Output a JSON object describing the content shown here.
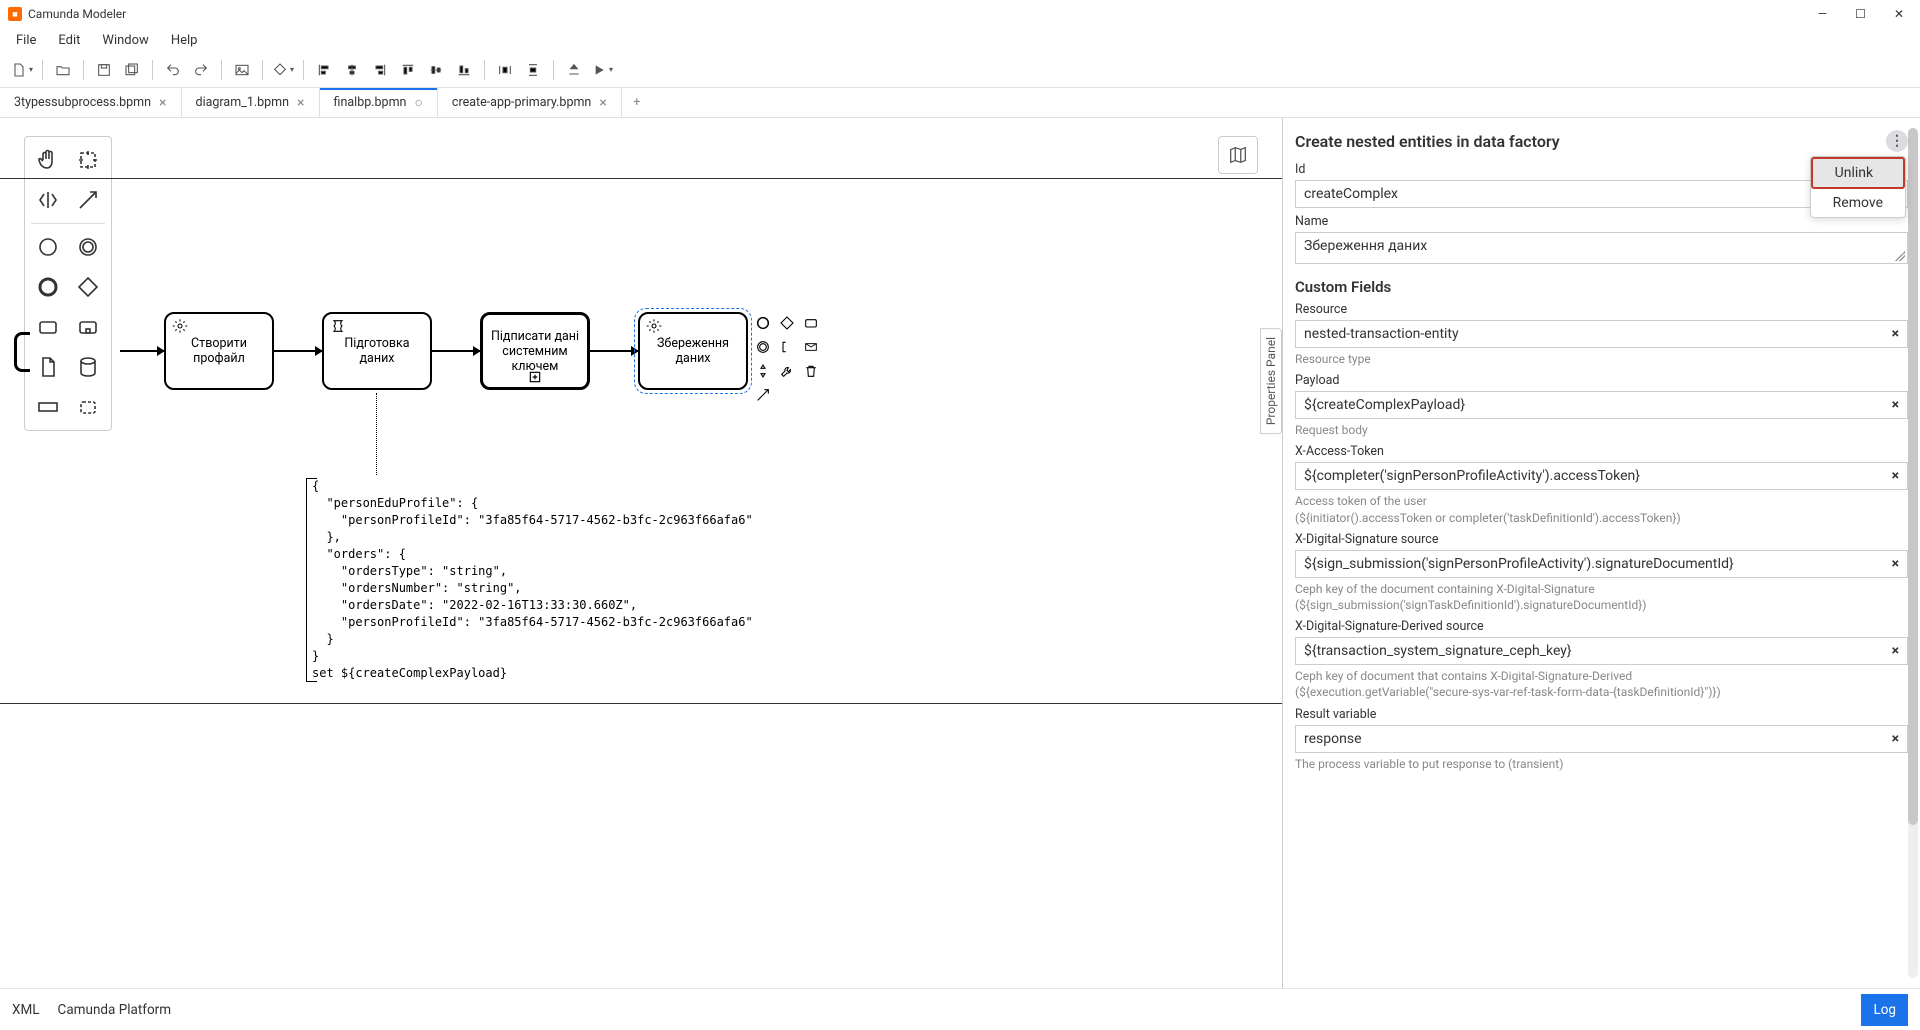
{
  "app_title": "Camunda Modeler",
  "menubar": [
    "File",
    "Edit",
    "Window",
    "Help"
  ],
  "tabs": [
    {
      "label": "3typessubprocess.bpmn",
      "active": false,
      "dirty": false
    },
    {
      "label": "diagram_1.bpmn",
      "active": false,
      "dirty": false
    },
    {
      "label": "finalbp.bpmn",
      "active": true,
      "dirty": true
    },
    {
      "label": "create-app-primary.bpmn",
      "active": false,
      "dirty": false
    }
  ],
  "palette_icons": [
    "hand",
    "lasso",
    "space",
    "connect",
    "start-event",
    "inter-event",
    "end-event",
    "gateway",
    "task",
    "sub",
    "data-object",
    "data-store",
    "pool",
    "group"
  ],
  "tasks": [
    {
      "id": "t1",
      "label": "Створити профайл",
      "icon": "gear"
    },
    {
      "id": "t2",
      "label": "Підготовка даних",
      "icon": "script"
    },
    {
      "id": "t3",
      "label": "Підписати дані системним ключем",
      "icon": "",
      "thick": true,
      "plus": true
    },
    {
      "id": "t4",
      "label": "Збереження даних",
      "icon": "gear",
      "selected": true
    }
  ],
  "annotation": "{\n  \"personEduProfile\": {\n    \"personProfileId\": \"3fa85f64-5717-4562-b3fc-2c963f66afa6\"\n  },\n  \"orders\": {\n    \"ordersType\": \"string\",\n    \"ordersNumber\": \"string\",\n    \"ordersDate\": \"2022-02-16T13:33:30.660Z\",\n    \"personProfileId\": \"3fa85f64-5717-4562-b3fc-2c963f66afa6\"\n  }\n}\nset ${createComplexPayload}",
  "vtab": "Properties Panel",
  "panel": {
    "title": "Create nested entities in data factory",
    "menu": {
      "unlink": "Unlink",
      "remove": "Remove"
    },
    "id_label": "Id",
    "id_value": "createComplex",
    "name_label": "Name",
    "name_value": "Збереження даних",
    "custom_header": "Custom Fields",
    "resource_label": "Resource",
    "resource_value": "nested-transaction-entity",
    "resource_hint": "Resource type",
    "payload_label": "Payload",
    "payload_value": "${createComplexPayload}",
    "payload_hint": "Request body",
    "token_label": "X-Access-Token",
    "token_value": "${completer('signPersonProfileActivity').accessToken}",
    "token_hint": "Access token of the user\n(${initiator().accessToken or completer('taskDefinitionId').accessToken})",
    "sig_label": "X-Digital-Signature source",
    "sig_value": "${sign_submission('signPersonProfileActivity').signatureDocumentId}",
    "sig_hint": "Ceph key of the document containing X-Digital-Signature\n(${sign_submission('signTaskDefinitionId').signatureDocumentId})",
    "sigd_label": "X-Digital-Signature-Derived source",
    "sigd_value": "${transaction_system_signature_ceph_key}",
    "sigd_hint": "Ceph key of document that contains X-Digital-Signature-Derived\n(${execution.getVariable(\"secure-sys-var-ref-task-form-data-{taskDefinitionId}\")})",
    "result_label": "Result variable",
    "result_value": "response",
    "result_hint": "The process variable to put response to (transient)"
  },
  "statusbar": {
    "xml": "XML",
    "platform": "Camunda Platform",
    "log": "Log"
  }
}
